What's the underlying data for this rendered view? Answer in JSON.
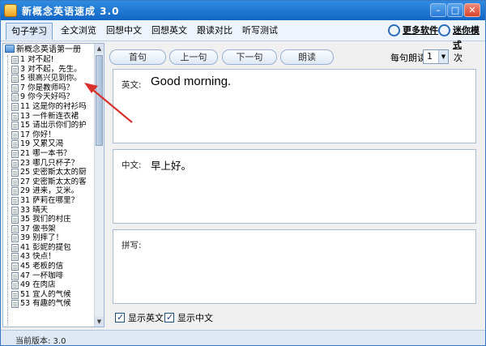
{
  "window": {
    "title": "新概念英语速成 3.0"
  },
  "menu": {
    "items": [
      {
        "label": "句子学习",
        "active": true
      },
      {
        "label": "全文浏览"
      },
      {
        "label": "回想中文"
      },
      {
        "label": "回想英文"
      },
      {
        "label": "跟读对比"
      },
      {
        "label": "听写测试"
      }
    ],
    "more_software": "更多软件",
    "mini_mode": "迷你模式"
  },
  "tree": {
    "root": "新概念英语第一册",
    "items": [
      "1 对不起!",
      "3 对不起，先生。",
      "5 很高兴见到你。",
      "7 你是教师吗？",
      "9 你今天好吗？",
      "11 这是你的衬衫吗",
      "13 一件新连衣裙",
      "15 请出示你们的护",
      "17 你好！",
      "19 又累又渴",
      "21 哪一本书？",
      "23 哪几只杯子？",
      "25 史密斯太太的厨",
      "27 史密斯太太的客",
      "29 进来，艾米。",
      "31 萨莉在哪里？",
      "33 晴天",
      "35 我们的村庄",
      "37 做书架",
      "39 别摔了！",
      "41 彭妮的提包",
      "43 快点！",
      "45 老板的信",
      "47 一杯咖啡",
      "49 在肉店",
      "51 宜人的气候",
      "53 有趣的气候"
    ]
  },
  "toolbar": {
    "first": "首句",
    "prev": "上一句",
    "next": "下一句",
    "read": "朗读",
    "per_read_label": "每句朗读",
    "per_read_value": "1",
    "per_read_unit": "次"
  },
  "panels": {
    "english_label": "英文:",
    "english_text": "Good morning.",
    "chinese_label": "中文:",
    "chinese_text": "早上好。",
    "dictation_label": "拼写:"
  },
  "options": {
    "show_english": "显示英文",
    "show_chinese": "显示中文"
  },
  "status": {
    "version": "当前版本: 3.0"
  },
  "colors": {
    "title_bar": "#1f77d4",
    "accent": "#2c6db8",
    "arrow": "#d9302c"
  }
}
